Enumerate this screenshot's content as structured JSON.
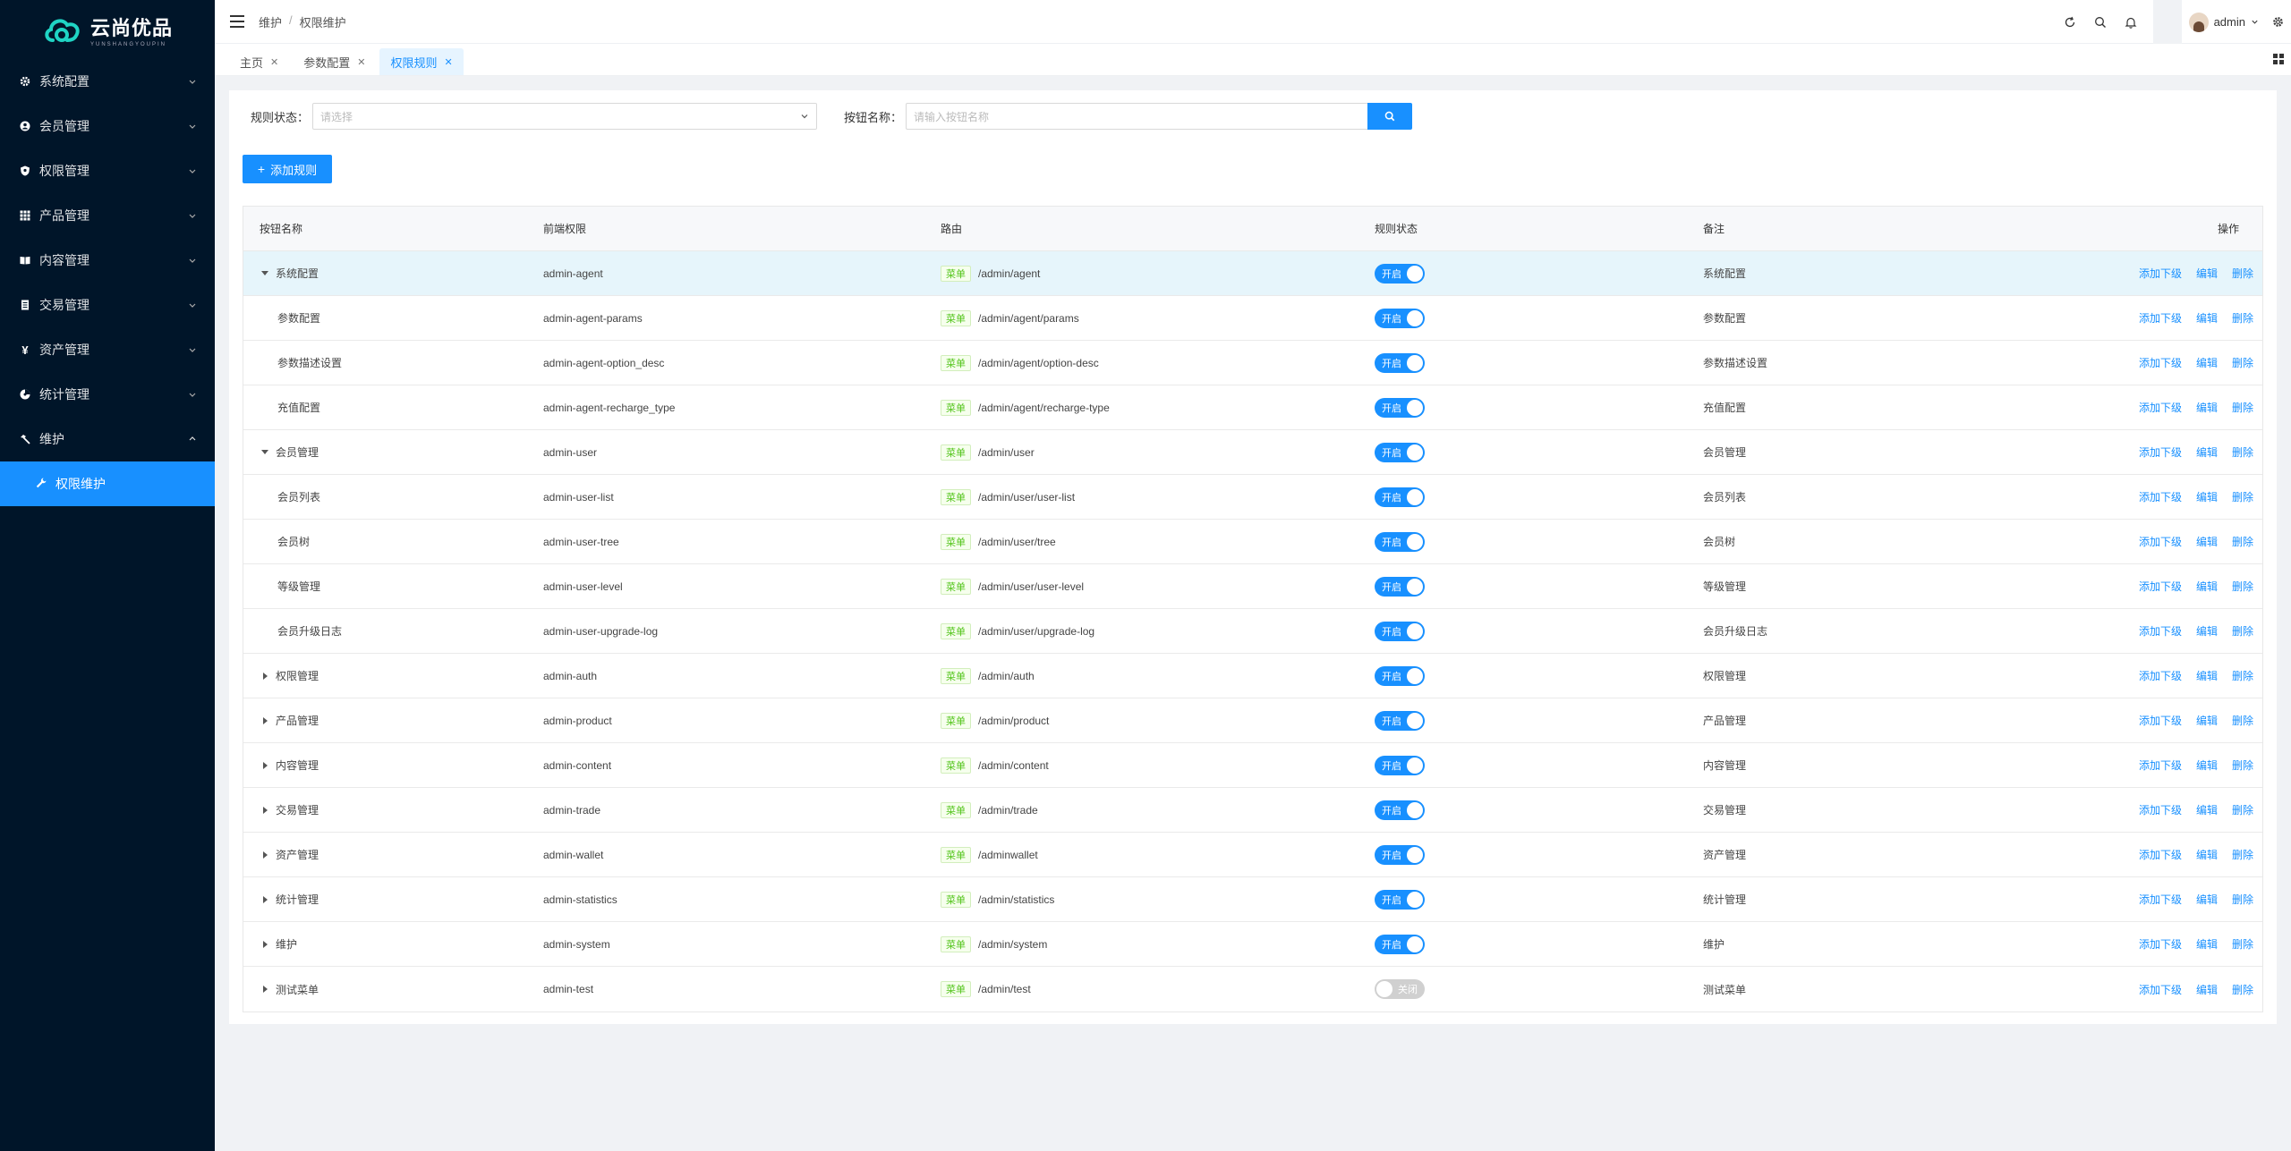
{
  "app": {
    "name": "云尚优品",
    "subtitle": "YUNSHANGYOUPIN"
  },
  "sidebar": {
    "items": [
      {
        "label": "系统配置",
        "icon": "gear-icon"
      },
      {
        "label": "会员管理",
        "icon": "user-icon"
      },
      {
        "label": "权限管理",
        "icon": "shield-icon"
      },
      {
        "label": "产品管理",
        "icon": "grid-icon"
      },
      {
        "label": "内容管理",
        "icon": "book-icon"
      },
      {
        "label": "交易管理",
        "icon": "document-icon"
      },
      {
        "label": "资产管理",
        "icon": "yen-icon"
      },
      {
        "label": "统计管理",
        "icon": "chart-icon"
      },
      {
        "label": "维护",
        "icon": "hammer-icon"
      }
    ],
    "active_sub": {
      "label": "权限维护",
      "icon": "wrench-icon"
    }
  },
  "breadcrumb": [
    "维护",
    "权限维护"
  ],
  "header": {
    "username": "admin"
  },
  "tabs": [
    {
      "label": "主页",
      "active": false
    },
    {
      "label": "参数配置",
      "active": false
    },
    {
      "label": "权限规则",
      "active": true
    }
  ],
  "filters": {
    "status_label": "规则状态：",
    "status_placeholder": "请选择",
    "name_label": "按钮名称：",
    "name_placeholder": "请输入按钮名称"
  },
  "add_button": "添加规则",
  "table": {
    "headers": [
      "按钮名称",
      "前端权限",
      "路由",
      "规则状态",
      "备注",
      "操作"
    ],
    "tag_label": "菜单",
    "on_label": "开启",
    "off_label": "关闭",
    "actions": [
      "添加下级",
      "编辑",
      "删除"
    ],
    "rows": [
      {
        "name": "系统配置",
        "perm": "admin-agent",
        "route": "/admin/agent",
        "enabled": true,
        "note": "系统配置"
      },
      {
        "name": "参数配置",
        "perm": "admin-agent-params",
        "route": "/admin/agent/params",
        "enabled": true,
        "note": "参数配置"
      },
      {
        "name": "参数描述设置",
        "perm": "admin-agent-option_desc",
        "route": "/admin/agent/option-desc",
        "enabled": true,
        "note": "参数描述设置"
      },
      {
        "name": "充值配置",
        "perm": "admin-agent-recharge_type",
        "route": "/admin/agent/recharge-type",
        "enabled": true,
        "note": "充值配置"
      },
      {
        "name": "会员管理",
        "perm": "admin-user",
        "route": "/admin/user",
        "enabled": true,
        "note": "会员管理"
      },
      {
        "name": "会员列表",
        "perm": "admin-user-list",
        "route": "/admin/user/user-list",
        "enabled": true,
        "note": "会员列表"
      },
      {
        "name": "会员树",
        "perm": "admin-user-tree",
        "route": "/admin/user/tree",
        "enabled": true,
        "note": "会员树"
      },
      {
        "name": "等级管理",
        "perm": "admin-user-level",
        "route": "/admin/user/user-level",
        "enabled": true,
        "note": "等级管理"
      },
      {
        "name": "会员升级日志",
        "perm": "admin-user-upgrade-log",
        "route": "/admin/user/upgrade-log",
        "enabled": true,
        "note": "会员升级日志"
      },
      {
        "name": "权限管理",
        "perm": "admin-auth",
        "route": "/admin/auth",
        "enabled": true,
        "note": "权限管理"
      },
      {
        "name": "产品管理",
        "perm": "admin-product",
        "route": "/admin/product",
        "enabled": true,
        "note": "产品管理"
      },
      {
        "name": "内容管理",
        "perm": "admin-content",
        "route": "/admin/content",
        "enabled": true,
        "note": "内容管理"
      },
      {
        "name": "交易管理",
        "perm": "admin-trade",
        "route": "/admin/trade",
        "enabled": true,
        "note": "交易管理"
      },
      {
        "name": "资产管理",
        "perm": "admin-wallet",
        "route": "/adminwallet",
        "enabled": true,
        "note": "资产管理"
      },
      {
        "name": "统计管理",
        "perm": "admin-statistics",
        "route": "/admin/statistics",
        "enabled": true,
        "note": "统计管理"
      },
      {
        "name": "维护",
        "perm": "admin-system",
        "route": "/admin/system",
        "enabled": true,
        "note": "维护"
      },
      {
        "name": "测试菜单",
        "perm": "admin-test",
        "route": "/admin/test",
        "enabled": false,
        "note": "测试菜单"
      }
    ]
  },
  "colors": {
    "primary": "#1890ff",
    "sidebar_bg": "#001529",
    "tag_green": "#52c41a"
  }
}
